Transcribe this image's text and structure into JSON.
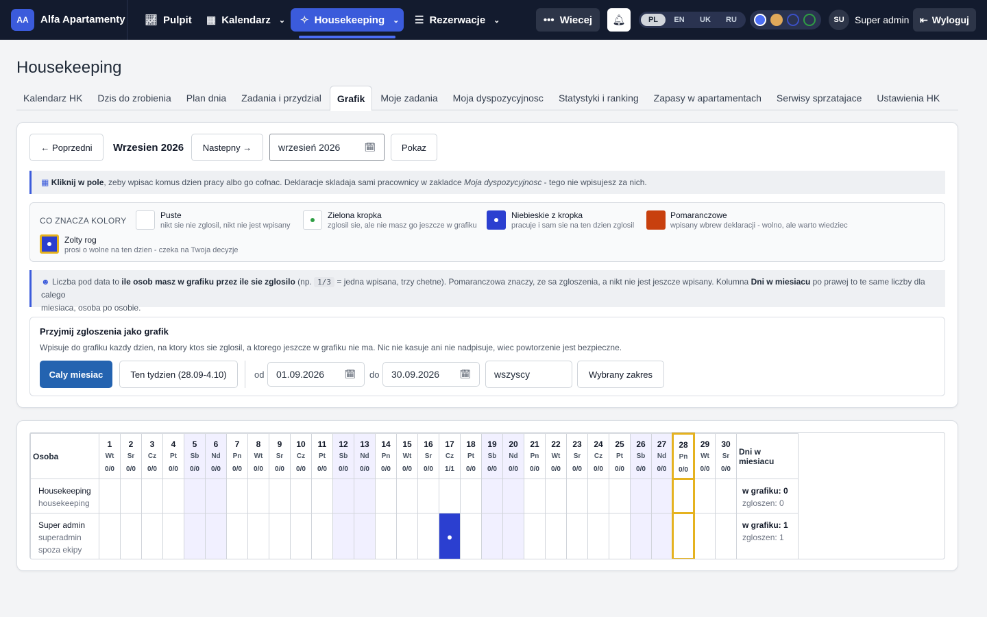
{
  "nav": {
    "brand_badge": "AA",
    "brand_name": "Alfa Apartamenty",
    "items": [
      {
        "label": "Pulpit",
        "icon": "chart-icon"
      },
      {
        "label": "Kalendarz",
        "icon": "calendar-icon"
      },
      {
        "label": "Housekeeping",
        "icon": "cleaning-icon"
      },
      {
        "label": "Rezerwacje",
        "icon": "list-icon"
      }
    ],
    "more_label": "Wiecej",
    "languages": [
      "PL",
      "EN",
      "UK",
      "RU"
    ],
    "active_language": "PL",
    "theme_colors": [
      "#4c6ef5",
      "#e0a85a",
      "#3b4fc4",
      "#2f9e44"
    ],
    "avatar": "SU",
    "user_name": "Super admin",
    "logout_label": "Wyloguj"
  },
  "page": {
    "title": "Housekeeping",
    "tabs": [
      "Kalendarz HK",
      "Dzis do zrobienia",
      "Plan dnia",
      "Zadania i przydzial",
      "Grafik",
      "Moje zadania",
      "Moja dyspozycyjnosc",
      "Statystyki i ranking",
      "Zapasy w apartamentach",
      "Serwisy sprzatajace",
      "Ustawienia HK"
    ],
    "active_tab": "Grafik"
  },
  "month_nav": {
    "prev_label": "← Poprzedni",
    "current_month": "Wrzesien 2026",
    "next_label": "Nastepny →",
    "month_input": "wrzesień 2026",
    "show_label": "Pokaz"
  },
  "info1": {
    "bold": "Kliknij w pole",
    "text": ", zeby wpisac komus dzien pracy albo go cofnac. Deklaracje skladaja sami pracownicy w zakladce ",
    "italic": "Moja dyspozycyjnosc",
    "tail": " - tego nie wpisujesz za nich."
  },
  "legend": {
    "title": "CO ZNACZA KOLORY",
    "items": [
      {
        "title": "Puste",
        "desc": "nikt sie nie zglosil, nikt nie jest wpisany"
      },
      {
        "title": "Zielona kropka",
        "desc": "zglosil sie, ale nie masz go jeszcze w grafiku"
      },
      {
        "title": "Niebieskie z kropka",
        "desc": "pracuje i sam sie na ten dzien zglosil"
      },
      {
        "title": "Pomaranczowe",
        "desc": "wpisany wbrew deklaracji - wolno, ale warto wiedziec"
      },
      {
        "title": "Zolty rog",
        "desc": "prosi o wolne na ten dzien - czeka na Twoja decyzje"
      }
    ]
  },
  "info2": {
    "lead": "Liczba pod data to ",
    "bold1": "ile osob masz w grafiku przez ile sie zglosilo",
    "mid": " (np. ",
    "example": "1/3",
    "mid2": " = jedna wpisana, trzy chetne). Pomaranczowa znaczy, ze sa zgloszenia, a nikt nie jest jeszcze wpisany. Kolumna ",
    "bold2": "Dni w miesiacu",
    "line1_end": " po prawej to te same liczby dla calego",
    "line2": "miesiaca, osoba po osobie."
  },
  "accept": {
    "title": "Przyjmij zgloszenia jako grafik",
    "desc": "Wpisuje do grafiku kazdy dzien, na ktory ktos sie zglosil, a ktorego jeszcze w grafiku nie ma. Nic nie kasuje ani nie nadpisuje, wiec powtorzenie jest bezpieczne.",
    "whole_month": "Caly miesiac",
    "this_week": "Ten tydzien (28.09-4.10)",
    "from_label": "od",
    "from_value": "01.09.2026",
    "to_label": "do",
    "to_value": "30.09.2026",
    "who_value": "wszyscy",
    "range_button": "Wybrany zakres"
  },
  "schedule": {
    "person_header": "Osoba",
    "total_header": "Dni w miesiacu",
    "days": [
      {
        "n": "1",
        "w": "Wt",
        "c": "0/0"
      },
      {
        "n": "2",
        "w": "Sr",
        "c": "0/0"
      },
      {
        "n": "3",
        "w": "Cz",
        "c": "0/0"
      },
      {
        "n": "4",
        "w": "Pt",
        "c": "0/0"
      },
      {
        "n": "5",
        "w": "Sb",
        "c": "0/0"
      },
      {
        "n": "6",
        "w": "Nd",
        "c": "0/0"
      },
      {
        "n": "7",
        "w": "Pn",
        "c": "0/0"
      },
      {
        "n": "8",
        "w": "Wt",
        "c": "0/0"
      },
      {
        "n": "9",
        "w": "Sr",
        "c": "0/0"
      },
      {
        "n": "10",
        "w": "Cz",
        "c": "0/0"
      },
      {
        "n": "11",
        "w": "Pt",
        "c": "0/0"
      },
      {
        "n": "12",
        "w": "Sb",
        "c": "0/0"
      },
      {
        "n": "13",
        "w": "Nd",
        "c": "0/0"
      },
      {
        "n": "14",
        "w": "Pn",
        "c": "0/0"
      },
      {
        "n": "15",
        "w": "Wt",
        "c": "0/0"
      },
      {
        "n": "16",
        "w": "Sr",
        "c": "0/0"
      },
      {
        "n": "17",
        "w": "Cz",
        "c": "1/1"
      },
      {
        "n": "18",
        "w": "Pt",
        "c": "0/0"
      },
      {
        "n": "19",
        "w": "Sb",
        "c": "0/0"
      },
      {
        "n": "20",
        "w": "Nd",
        "c": "0/0"
      },
      {
        "n": "21",
        "w": "Pn",
        "c": "0/0"
      },
      {
        "n": "22",
        "w": "Wt",
        "c": "0/0"
      },
      {
        "n": "23",
        "w": "Sr",
        "c": "0/0"
      },
      {
        "n": "24",
        "w": "Cz",
        "c": "0/0"
      },
      {
        "n": "25",
        "w": "Pt",
        "c": "0/0"
      },
      {
        "n": "26",
        "w": "Sb",
        "c": "0/0"
      },
      {
        "n": "27",
        "w": "Nd",
        "c": "0/0"
      },
      {
        "n": "28",
        "w": "Pn",
        "c": "0/0"
      },
      {
        "n": "29",
        "w": "Wt",
        "c": "0/0"
      },
      {
        "n": "30",
        "w": "Sr",
        "c": "0/0"
      }
    ],
    "today_day": 28,
    "rows": [
      {
        "name": "Housekeeping",
        "role": "housekeeping",
        "note": "",
        "assigned_days": [],
        "total": "w grafiku: 0",
        "requests": "zgloszen: 0"
      },
      {
        "name": "Super admin",
        "role": "superadmin",
        "note": "spoza ekipy",
        "assigned_days": [
          17
        ],
        "total": "w grafiku: 1",
        "requests": "zgloszen: 1"
      }
    ]
  }
}
